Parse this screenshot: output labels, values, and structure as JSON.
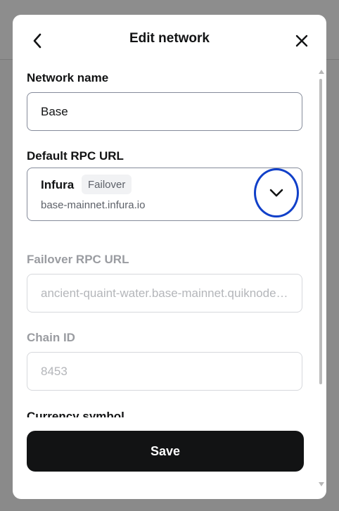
{
  "modal": {
    "title": "Edit network",
    "back_icon": "chevron-left-icon",
    "close_icon": "close-icon"
  },
  "network_name": {
    "label": "Network name",
    "value": "Base"
  },
  "default_rpc": {
    "label": "Default RPC URL",
    "name": "Infura",
    "badge": "Failover",
    "url": "base-mainnet.infura.io",
    "dropdown_icon": "chevron-down-icon"
  },
  "failover_rpc": {
    "label": "Failover RPC URL",
    "value": "ancient-quaint-water.base-mainnet.quiknode.pro"
  },
  "chain_id": {
    "label": "Chain ID",
    "value": "8453"
  },
  "currency_symbol": {
    "label": "Currency symbol"
  },
  "save_label": "Save",
  "colors": {
    "accent_ring": "#1140c9",
    "primary_button": "#121314",
    "muted_text": "#9a9ca1"
  }
}
